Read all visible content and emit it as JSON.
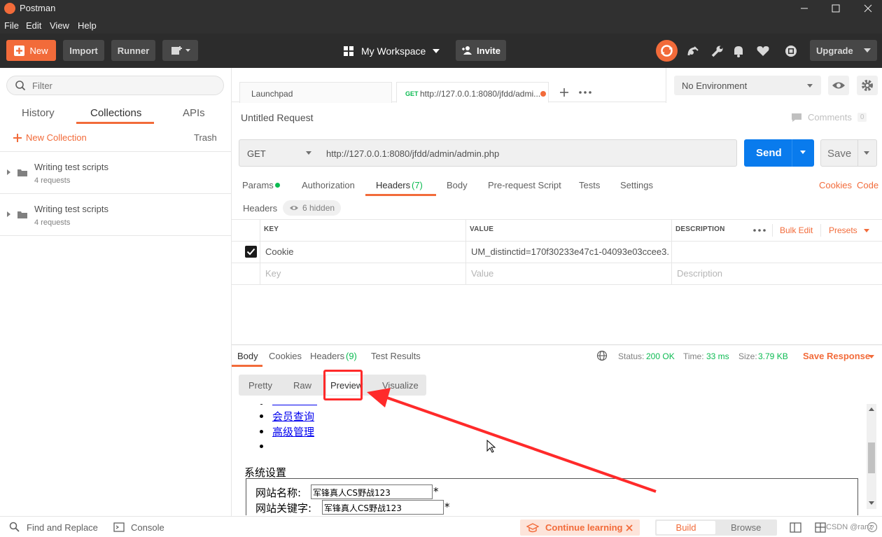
{
  "window": {
    "title": "Postman"
  },
  "menu": [
    "File",
    "Edit",
    "View",
    "Help"
  ],
  "toolbar": {
    "new_label": "New",
    "import_label": "Import",
    "runner_label": "Runner",
    "workspace_label": "My Workspace",
    "invite_label": "Invite",
    "upgrade_label": "Upgrade"
  },
  "sidebar": {
    "filter_placeholder": "Filter",
    "tabs": [
      "History",
      "Collections",
      "APIs"
    ],
    "active_tab": "Collections",
    "new_collection_label": "New Collection",
    "trash_label": "Trash",
    "collections": [
      {
        "name": "Writing test scripts",
        "count": "4 requests"
      },
      {
        "name": "Writing test scripts",
        "count": "4 requests"
      }
    ]
  },
  "request_tabs": {
    "launchpad": "Launchpad",
    "active_method": "GET",
    "active_url": "http://127.0.0.1:8080/jfdd/admi..."
  },
  "environment": {
    "selected": "No Environment"
  },
  "request": {
    "title": "Untitled Request",
    "comments_label": "Comments",
    "comments_count": "0",
    "method": "GET",
    "url": "http://127.0.0.1:8080/jfdd/admin/admin.php",
    "send_label": "Send",
    "save_label": "Save",
    "tabs": {
      "params": "Params",
      "authorization": "Authorization",
      "headers": "Headers",
      "headers_count": "(7)",
      "body": "Body",
      "prerequest": "Pre-request Script",
      "tests": "Tests",
      "settings": "Settings"
    },
    "cookies_link": "Cookies",
    "code_link": "Code",
    "headers_label": "Headers",
    "hidden_label": "6 hidden",
    "table": {
      "key_header": "KEY",
      "value_header": "VALUE",
      "description_header": "DESCRIPTION",
      "bulk_edit": "Bulk Edit",
      "presets": "Presets",
      "row_key": "Cookie",
      "row_value": "UM_distinctid=170f30233e47c1-04093e03ccee3...",
      "key_placeholder": "Key",
      "value_placeholder": "Value",
      "description_placeholder": "Description"
    }
  },
  "response": {
    "tabs": {
      "body": "Body",
      "cookies": "Cookies",
      "headers": "Headers",
      "headers_count": "(9)",
      "test_results": "Test Results"
    },
    "status_label": "Status:",
    "status_value": "200 OK",
    "time_label": "Time:",
    "time_value": "33 ms",
    "size_label": "Size:",
    "size_value": "3.79 KB",
    "save_response": "Save Response",
    "view_modes": [
      "Pretty",
      "Raw",
      "Preview",
      "Visualize"
    ],
    "active_mode": "Preview",
    "preview": {
      "links": [
        "会员查询",
        "高级管理"
      ],
      "section_title": "系统设置",
      "site_name_label": "网站名称:",
      "site_name_value": "军锋真人CS野战123",
      "site_keywords_label": "网站关键字:",
      "site_keywords_value": "军锋真人CS野战123",
      "required_mark": "*"
    }
  },
  "footer": {
    "find_replace": "Find and Replace",
    "console": "Console",
    "continue_learning": "Continue learning",
    "build": "Build",
    "browse": "Browse",
    "watermark": "CSDN @ranz"
  },
  "colors": {
    "brand_orange": "#f26b3a",
    "send_blue": "#097bed",
    "status_green": "#0cbb52",
    "annotation_red": "#ff2a2a"
  }
}
